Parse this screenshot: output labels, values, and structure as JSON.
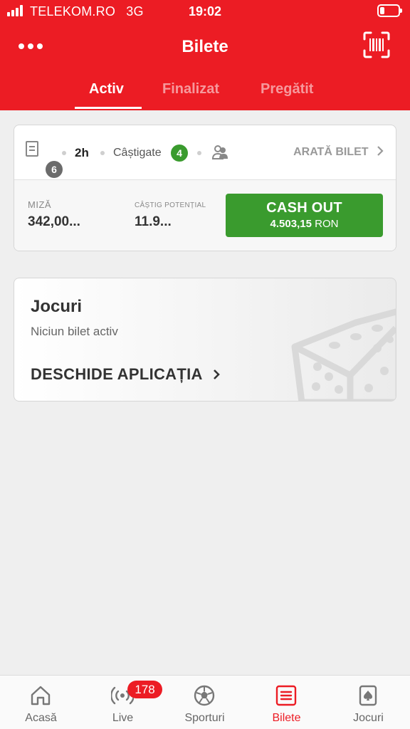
{
  "status_bar": {
    "carrier": "TELEKOM.RO",
    "network": "3G",
    "time": "19:02"
  },
  "header": {
    "title": "Bilete"
  },
  "tabs": [
    {
      "label": "Activ",
      "active": true
    },
    {
      "label": "Finalizat",
      "active": false
    },
    {
      "label": "Pregătit",
      "active": false
    }
  ],
  "ticket": {
    "events_count": "6",
    "time_left": "2h",
    "won_label": "Câștigate",
    "won_count": "4",
    "show_label": "ARATĂ BILET",
    "stake_label": "MIZĂ",
    "stake_value": "342,00...",
    "potential_label": "CÂȘTIG POTENȚIAL",
    "potential_value": "11.9...",
    "cashout_label": "CASH OUT",
    "cashout_amount": "4.503,15",
    "cashout_currency": "RON"
  },
  "games_card": {
    "title": "Jocuri",
    "subtitle": "Niciun bilet activ",
    "link_label": "DESCHIDE APLICAȚIA"
  },
  "bottom_nav": [
    {
      "label": "Acasă",
      "icon": "home-icon"
    },
    {
      "label": "Live",
      "icon": "live-broadcast-icon",
      "badge": "178"
    },
    {
      "label": "Sporturi",
      "icon": "soccer-ball-icon"
    },
    {
      "label": "Bilete",
      "icon": "ticket-icon",
      "active": true
    },
    {
      "label": "Jocuri",
      "icon": "playing-card-icon"
    }
  ],
  "colors": {
    "brand_red": "#ec1c24",
    "cashout_green": "#3a9b2e",
    "background": "#efefef"
  }
}
